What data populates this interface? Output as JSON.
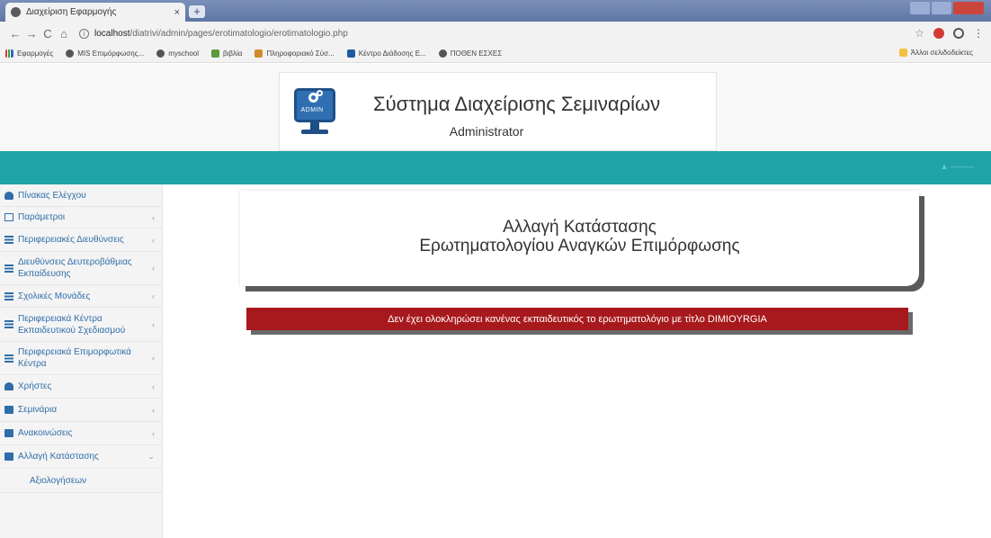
{
  "browser": {
    "tab_title": "Διαχείριση Εφαρμογής",
    "tab_close": "×",
    "new_tab": "+",
    "url_host": "localhost",
    "url_path": "/diatrivi/admin/pages/erotimatologio/erotimatologio.php",
    "bookmarks": [
      "Εφαρμογές",
      "MIS Επιμόρφωσης...",
      "myschool",
      "βιβλία",
      "Πληροφοριακό Σύσ...",
      "Κέντρο Διάδοσης Ε...",
      "ΠΟΘΕΝ ΕΣΧΕΣ"
    ],
    "other_bookmarks": "Άλλοι σελιδοδείκτες"
  },
  "header": {
    "logo_label": "ADMIN",
    "title": "Σύστημα Διαχείρισης Σεμιναρίων",
    "subtitle": "Administrator"
  },
  "sidebar": {
    "items": [
      {
        "label": "Πίνακας Ελέγχου",
        "icon": "dashboard-icon"
      },
      {
        "label": "Παράμετροι",
        "icon": "parameters-icon"
      },
      {
        "label": "Περιφερειακές Διευθύνσεις",
        "icon": "list-icon"
      },
      {
        "label": "Διευθύνσεις Δευτεροβάθμιας Εκπαίδευσης",
        "icon": "list-icon"
      },
      {
        "label": "Σχολικές Μονάδες",
        "icon": "list-icon"
      },
      {
        "label": "Περιφερειακά Κέντρα Εκπαιδευτικού Σχεδιασμού",
        "icon": "list-icon"
      },
      {
        "label": "Περιφερειακά Επιμορφωτικά Κέντρα",
        "icon": "list-icon"
      },
      {
        "label": "Χρήστες",
        "icon": "users-icon"
      },
      {
        "label": "Σεμινάρια",
        "icon": "folder-icon"
      },
      {
        "label": "Ανακοινώσεις",
        "icon": "folder-icon"
      },
      {
        "label": "Αλλαγή Κατάστασης",
        "icon": "folder-icon"
      }
    ],
    "subitems": [
      "Αξιολογήσεων"
    ]
  },
  "main": {
    "panel_line1": "Αλλαγή Κατάστασης",
    "panel_line2": "Ερωτηματολογίου Αναγκών Επιμόρφωσης",
    "alert_text": "Δεν έχει ολοκληρώσει κανένας εκπαιδευτικός το ερωτηματολόγιο με τίτλο DIMIOYRGIA"
  },
  "colors": {
    "teal_bar": "#1fa3a7",
    "alert_red": "#a8191d",
    "link_blue": "#2f6ea8"
  }
}
